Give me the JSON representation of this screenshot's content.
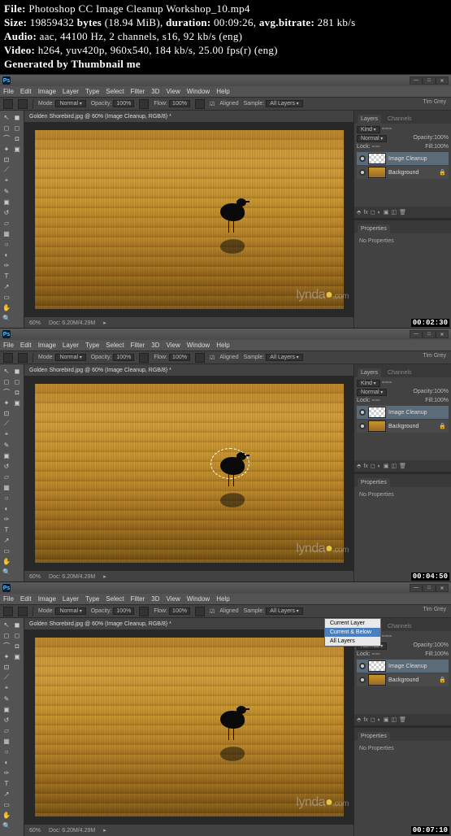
{
  "header": {
    "file_label": "File:",
    "file_value": "Photoshop CC Image Cleanup Workshop_10.mp4",
    "size_label": "Size:",
    "size_bytes": "19859432",
    "bytes_word": "bytes",
    "size_mib": "(18.94 MiB),",
    "duration_label": "duration:",
    "duration_value": "00:09:26,",
    "bitrate_label": "avg.bitrate:",
    "bitrate_value": "281 kb/s",
    "audio_label": "Audio:",
    "audio_value": "aac, 44100 Hz, 2 channels, s16, 92 kb/s (eng)",
    "video_label": "Video:",
    "video_value": "h264, yuv420p, 960x540, 184 kb/s, 25.00 fps(r) (eng)",
    "generated": "Generated by Thumbnail me"
  },
  "photoshop": {
    "menu": [
      "File",
      "Edit",
      "Image",
      "Layer",
      "Type",
      "Select",
      "Filter",
      "3D",
      "View",
      "Window",
      "Help"
    ],
    "profile": "Tim Grey",
    "options": {
      "mode": "Mode:",
      "mode_val": "Normal",
      "opac": "Opacity:",
      "opac_val": "100%",
      "flow": "Flow:",
      "flow_val": "100%",
      "aligned": "Aligned",
      "sample": "Sample:",
      "sample_val": "All Layers"
    },
    "dropdown": {
      "current": "Current Layer",
      "below": "Current & Below",
      "all": "All Layers"
    },
    "doc_tab": "Golden Shorebird.jpg @ 60% (Image Cleanup, RGB/8) *",
    "status_zoom": "60%",
    "status_doc": "Doc: 6.20M/4.29M",
    "panels": {
      "layers": "Layers",
      "channels": "Channels",
      "kind": "Kind",
      "normal": "Normal",
      "opacity": "Opacity:",
      "opacity_val": "100%",
      "lock": "Lock:",
      "fill": "Fill:",
      "fill_val": "100%",
      "layer_cleanup": "Image Cleanup",
      "layer_bg": "Background",
      "properties": "Properties",
      "no_props": "No Properties"
    },
    "lynda_text": "lynda",
    "lynda_com": ".com",
    "timestamps": [
      "00:02:30",
      "00:04:50",
      "00:07:10"
    ]
  }
}
